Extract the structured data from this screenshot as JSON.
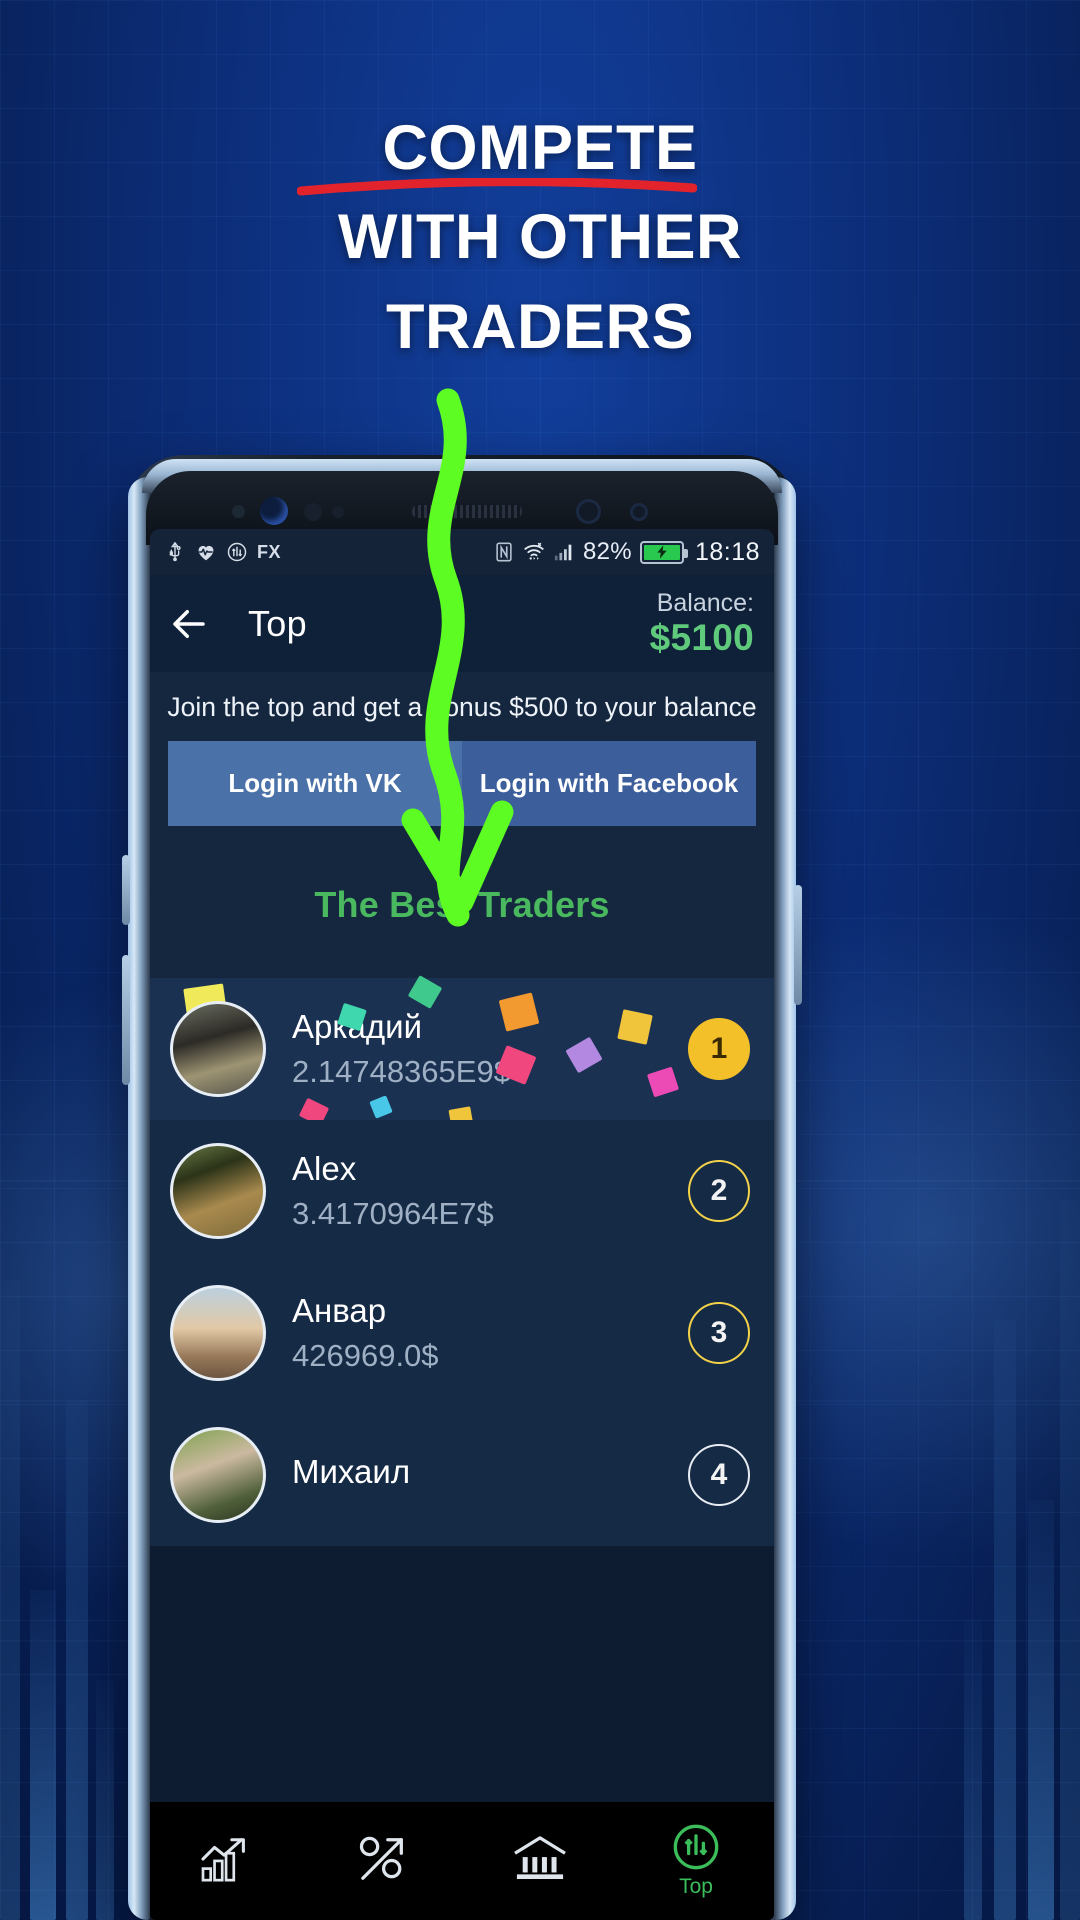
{
  "promo": {
    "headline_lines": [
      "COMPETE",
      "WITH OTHER",
      "TRADERS"
    ],
    "underline_color": "#e3232b",
    "arrow_color": "#5dfc22"
  },
  "statusbar": {
    "icons_left": [
      "usb-icon",
      "heart-rate-icon",
      "fx-chart-icon"
    ],
    "label_fx": "FX",
    "icons_right": [
      "nfc-icon",
      "wifi-icon",
      "signal-icon"
    ],
    "battery_percent": "82%",
    "battery_icon": "battery-charging-icon",
    "time": "18:18"
  },
  "appbar": {
    "back_icon": "back-arrow-icon",
    "title": "Top",
    "balance_label": "Balance:",
    "balance_value": "$5100",
    "balance_color": "#5fc97c"
  },
  "banner": {
    "text": "Join the top and get a bonus $500 to your balance"
  },
  "auth": {
    "vk_label": "Login with VK",
    "facebook_label": "Login with Facebook",
    "vk_color": "#4a72a8",
    "facebook_color": "#3c5f9c"
  },
  "leaderboard": {
    "title": "The Best Traders",
    "title_color": "#49b85f",
    "rows": [
      {
        "name": "Аркадий",
        "score": "2.14748365E9$",
        "rank": "1"
      },
      {
        "name": "Alex",
        "score": "3.4170964E7$",
        "rank": "2"
      },
      {
        "name": "Анвар",
        "score": "426969.0$",
        "rank": "3"
      },
      {
        "name": "Михаил",
        "score": "",
        "rank": "4"
      }
    ]
  },
  "bottomnav": {
    "items": [
      {
        "icon": "growth-chart-icon",
        "label": ""
      },
      {
        "icon": "percent-arrow-icon",
        "label": ""
      },
      {
        "icon": "bank-icon",
        "label": ""
      },
      {
        "icon": "top-chart-icon",
        "label": "Top"
      }
    ],
    "active_color": "#3bbd5a"
  }
}
